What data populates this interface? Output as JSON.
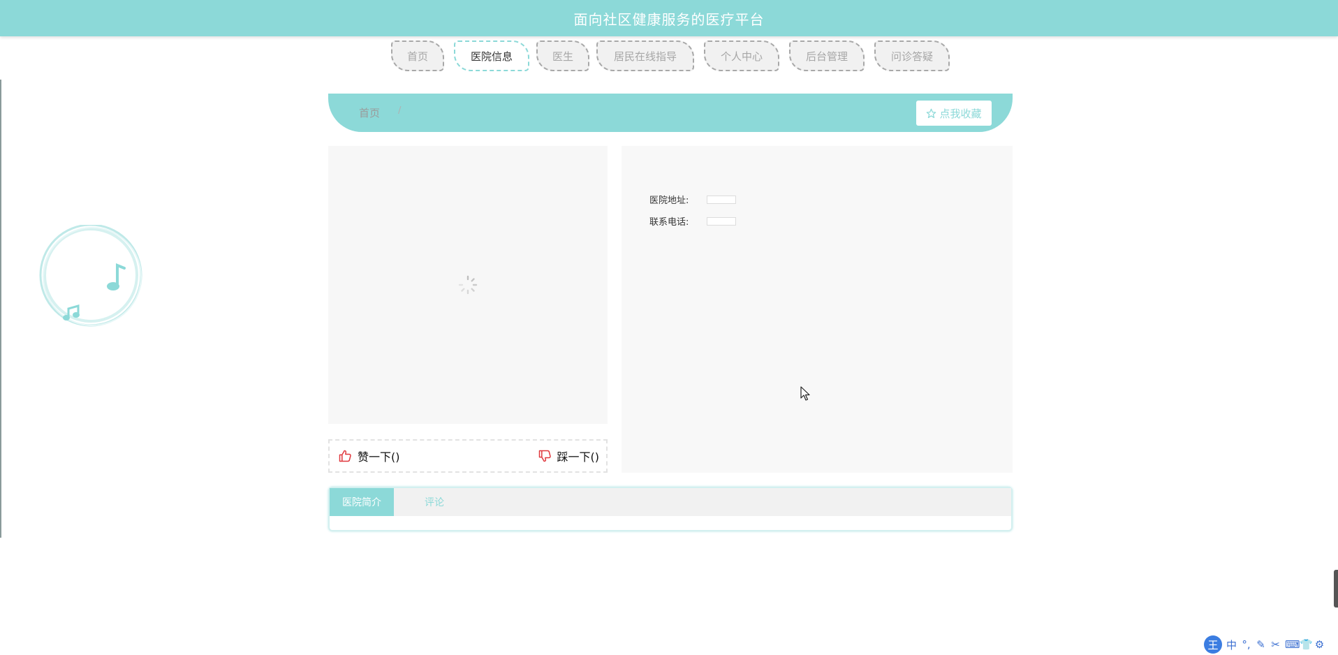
{
  "header": {
    "title": "面向社区健康服务的医疗平台"
  },
  "nav": {
    "items": [
      {
        "label": "首页"
      },
      {
        "label": "医院信息"
      },
      {
        "label": "医生"
      },
      {
        "label": "居民在线指导"
      },
      {
        "label": "个人中心"
      },
      {
        "label": "后台管理"
      },
      {
        "label": "问诊答疑"
      }
    ],
    "active": "医院信息"
  },
  "breadcrumb": {
    "home": "首页",
    "separator": "/"
  },
  "favorite": {
    "icon": "star-outline-icon",
    "label": "点我收藏"
  },
  "detail": {
    "address_label": "医院地址:",
    "address_value": "",
    "phone_label": "联系电话:",
    "phone_value": "",
    "image_state": "loading"
  },
  "votes": {
    "up_label": "赞一下()",
    "down_label": "踩一下()",
    "up_icon": "thumbs-up-icon",
    "down_icon": "thumbs-down-icon"
  },
  "tabs": [
    {
      "label": "医院简介",
      "active": true
    },
    {
      "label": "评论",
      "active": false
    }
  ],
  "ime": {
    "logo": "王",
    "items": [
      "中",
      "°,",
      "✎",
      "✂",
      "⌨",
      "👕",
      "⚙"
    ]
  },
  "colors": {
    "accent": "#8cd9d8",
    "accent_text": "#ffffff",
    "vote_icon": "#e0383e",
    "panel_bg": "#f7f7f7"
  }
}
